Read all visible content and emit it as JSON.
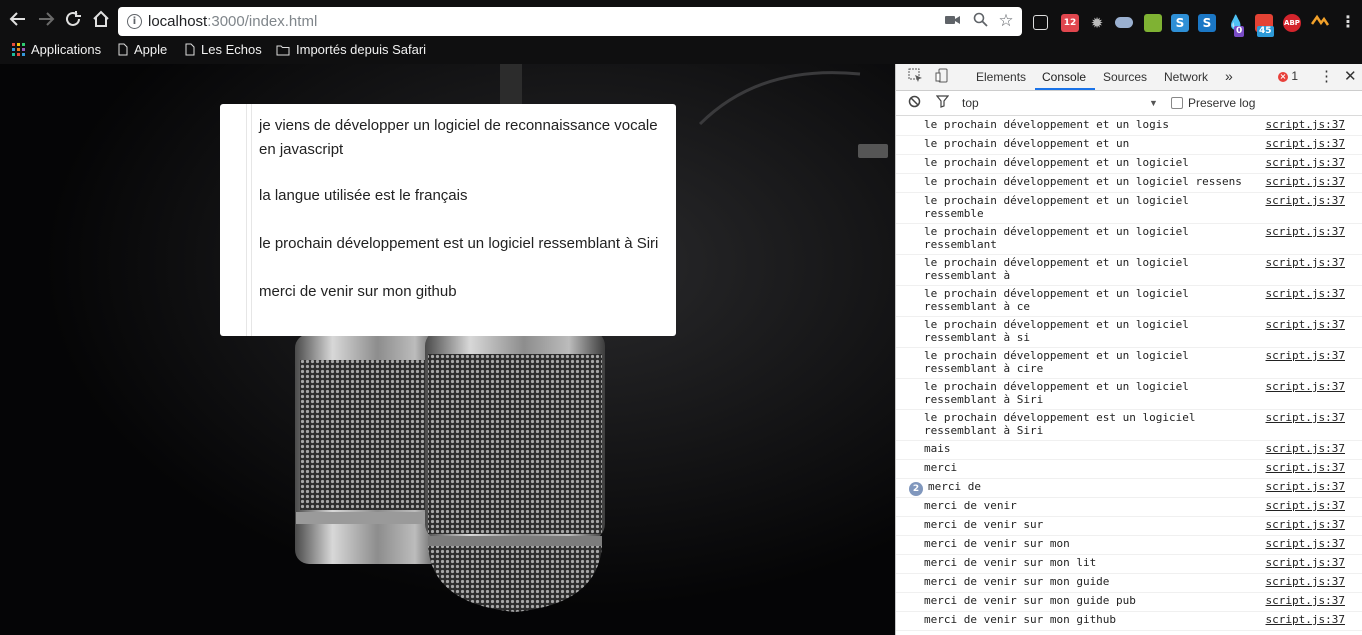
{
  "browser": {
    "url_host": "localhost",
    "url_path": ":3000/index.html",
    "ext_badges": [
      "12",
      "0",
      "45"
    ],
    "ext_labels": [
      "ABP"
    ]
  },
  "bookmarks": {
    "items": [
      {
        "label": "Applications",
        "icon": "apps-grid-icon"
      },
      {
        "label": "Apple",
        "icon": "page-icon"
      },
      {
        "label": "Les Echos",
        "icon": "page-icon"
      },
      {
        "label": "Importés depuis Safari",
        "icon": "folder-icon"
      }
    ]
  },
  "page": {
    "paragraphs": [
      "je viens de développer un logiciel de reconnaissance vocale en javascript",
      "la langue utilisée est le français",
      "le prochain développement est un logiciel ressemblant à Siri",
      "merci de venir sur mon github"
    ]
  },
  "devtools": {
    "tabs": [
      "Elements",
      "Console",
      "Sources",
      "Network"
    ],
    "active_tab": "Console",
    "error_count": "1",
    "context": "top",
    "preserve_log": "Preserve log",
    "source": "script.js:37",
    "logs": [
      {
        "text": "le prochain développement et un logis"
      },
      {
        "text": "le prochain développement et un"
      },
      {
        "text": "le prochain développement et un logiciel"
      },
      {
        "text": "le prochain développement et un logiciel ressens"
      },
      {
        "text": "le prochain développement et un logiciel\nressemble"
      },
      {
        "text": "le prochain développement et un logiciel\nressemblant"
      },
      {
        "text": "le prochain développement et un logiciel\nressemblant à"
      },
      {
        "text": "le prochain développement et un logiciel\nressemblant à ce"
      },
      {
        "text": "le prochain développement et un logiciel\nressemblant à si"
      },
      {
        "text": "le prochain développement et un logiciel\nressemblant à cire"
      },
      {
        "text": "le prochain développement et un logiciel\nressemblant à Siri"
      },
      {
        "text": "le prochain développement est un logiciel\nressemblant à Siri"
      },
      {
        "text": "mais"
      },
      {
        "text": "merci"
      },
      {
        "text": "merci de",
        "count": "2"
      },
      {
        "text": "merci de venir"
      },
      {
        "text": "merci de venir sur"
      },
      {
        "text": "merci de venir sur mon"
      },
      {
        "text": "merci de venir sur mon lit"
      },
      {
        "text": "merci de venir sur mon guide"
      },
      {
        "text": "merci de venir sur mon guide pub"
      },
      {
        "text": "merci de venir sur mon github"
      }
    ]
  }
}
